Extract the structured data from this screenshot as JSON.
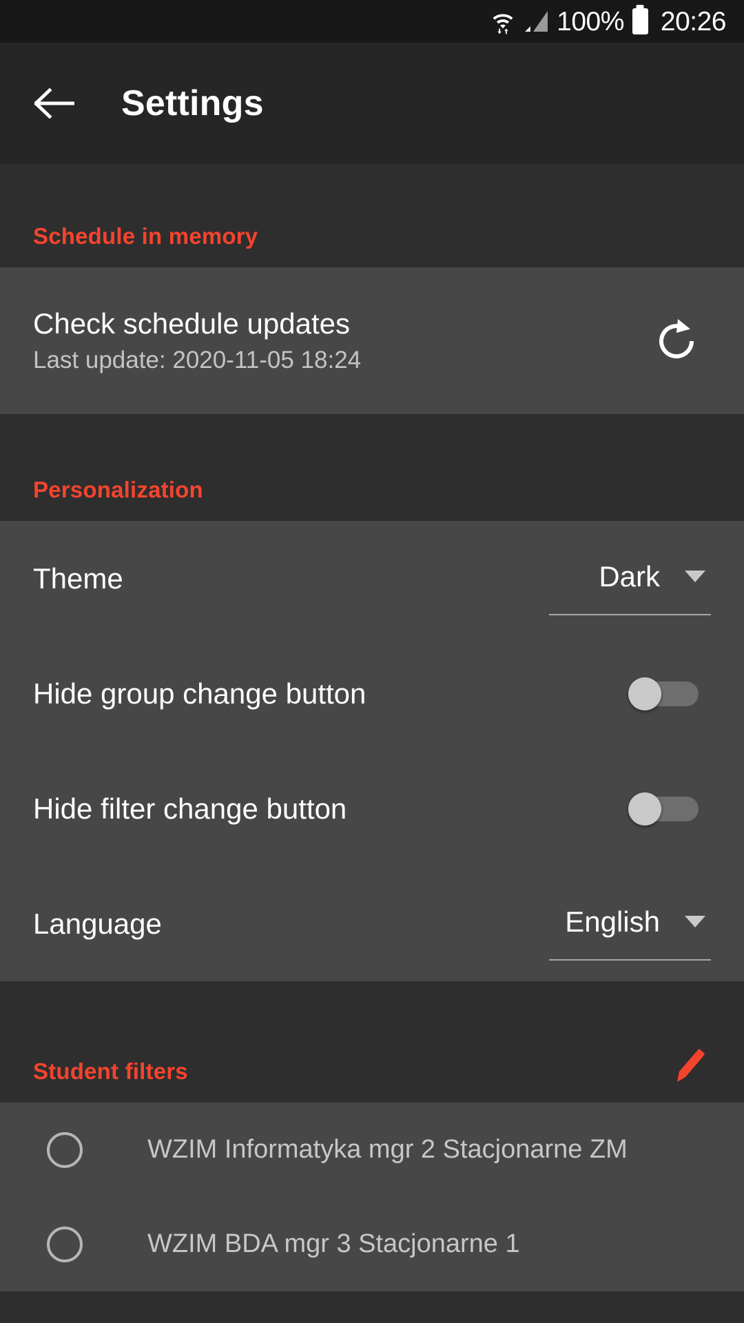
{
  "status_bar": {
    "wifi_icon": "wifi-with-transfer-arrows-icon",
    "signal_icon": "cellular-signal-icon",
    "battery_percent": "100%",
    "battery_icon": "battery-full-icon",
    "time": "20:26"
  },
  "app_bar": {
    "back_icon": "back-arrow-icon",
    "title": "Settings"
  },
  "colors": {
    "accent": "#f4442e",
    "status_bar_bg": "#181818",
    "app_bar_bg": "#262626",
    "section_bg": "#2e2e2e",
    "card_bg": "#474747",
    "primary_text": "#ffffff",
    "secondary_text": "#c4c4c4"
  },
  "sections": {
    "schedule": {
      "title": "Schedule in memory",
      "row": {
        "title": "Check schedule updates",
        "subtitle": "Last update: 2020-11-05 18:24",
        "action_icon": "refresh-icon"
      }
    },
    "personalization": {
      "title": "Personalization",
      "rows": [
        {
          "label": "Theme",
          "type": "spinner",
          "value": "Dark"
        },
        {
          "label": "Hide group change button",
          "type": "switch",
          "value": "off"
        },
        {
          "label": "Hide filter change button",
          "type": "switch",
          "value": "off"
        },
        {
          "label": "Language",
          "type": "spinner",
          "value": "English"
        }
      ]
    },
    "student_filters": {
      "title": "Student filters",
      "edit_icon": "pencil-edit-icon",
      "items": [
        {
          "label": "WZIM Informatyka mgr 2 Stacjonarne ZM",
          "selected": false
        },
        {
          "label": "WZIM BDA mgr 3 Stacjonarne 1",
          "selected": false
        }
      ]
    }
  }
}
